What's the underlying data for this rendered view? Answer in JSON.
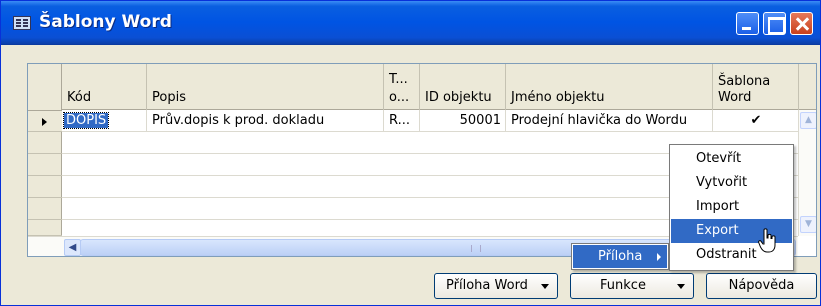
{
  "window": {
    "title": "Šablony Word"
  },
  "columns": [
    "Kód",
    "Popis",
    "T...\no...",
    "ID objektu",
    "Jméno objektu",
    "Šablona\nWord"
  ],
  "column_labels": {
    "kod": "Kód",
    "popis": "Popis",
    "typ_line1": "T...",
    "typ_line2": "o...",
    "id": "ID objektu",
    "jmeno": "Jméno objektu",
    "sablona_line1": "Šablona",
    "sablona_line2": "Word"
  },
  "rows": [
    {
      "kod": "DOPIS",
      "popis": "Prův.dopis k prod. dokladu",
      "typ": "R...",
      "id": "50001",
      "jmeno": "Prodejní hlavička do Wordu",
      "sablona": "✔"
    }
  ],
  "buttons": {
    "priloha_word": "Příloha Word",
    "funkce": "Funkce",
    "napoveda": "Nápověda"
  },
  "submenu": {
    "priloha": "Příloha"
  },
  "menu": {
    "items": [
      "Otevřít",
      "Vytvořit",
      "Import",
      "Export",
      "Odstranit"
    ],
    "highlighted": "Export"
  },
  "colors": {
    "titlebar": "#0054e3",
    "selection": "#316ac5"
  }
}
